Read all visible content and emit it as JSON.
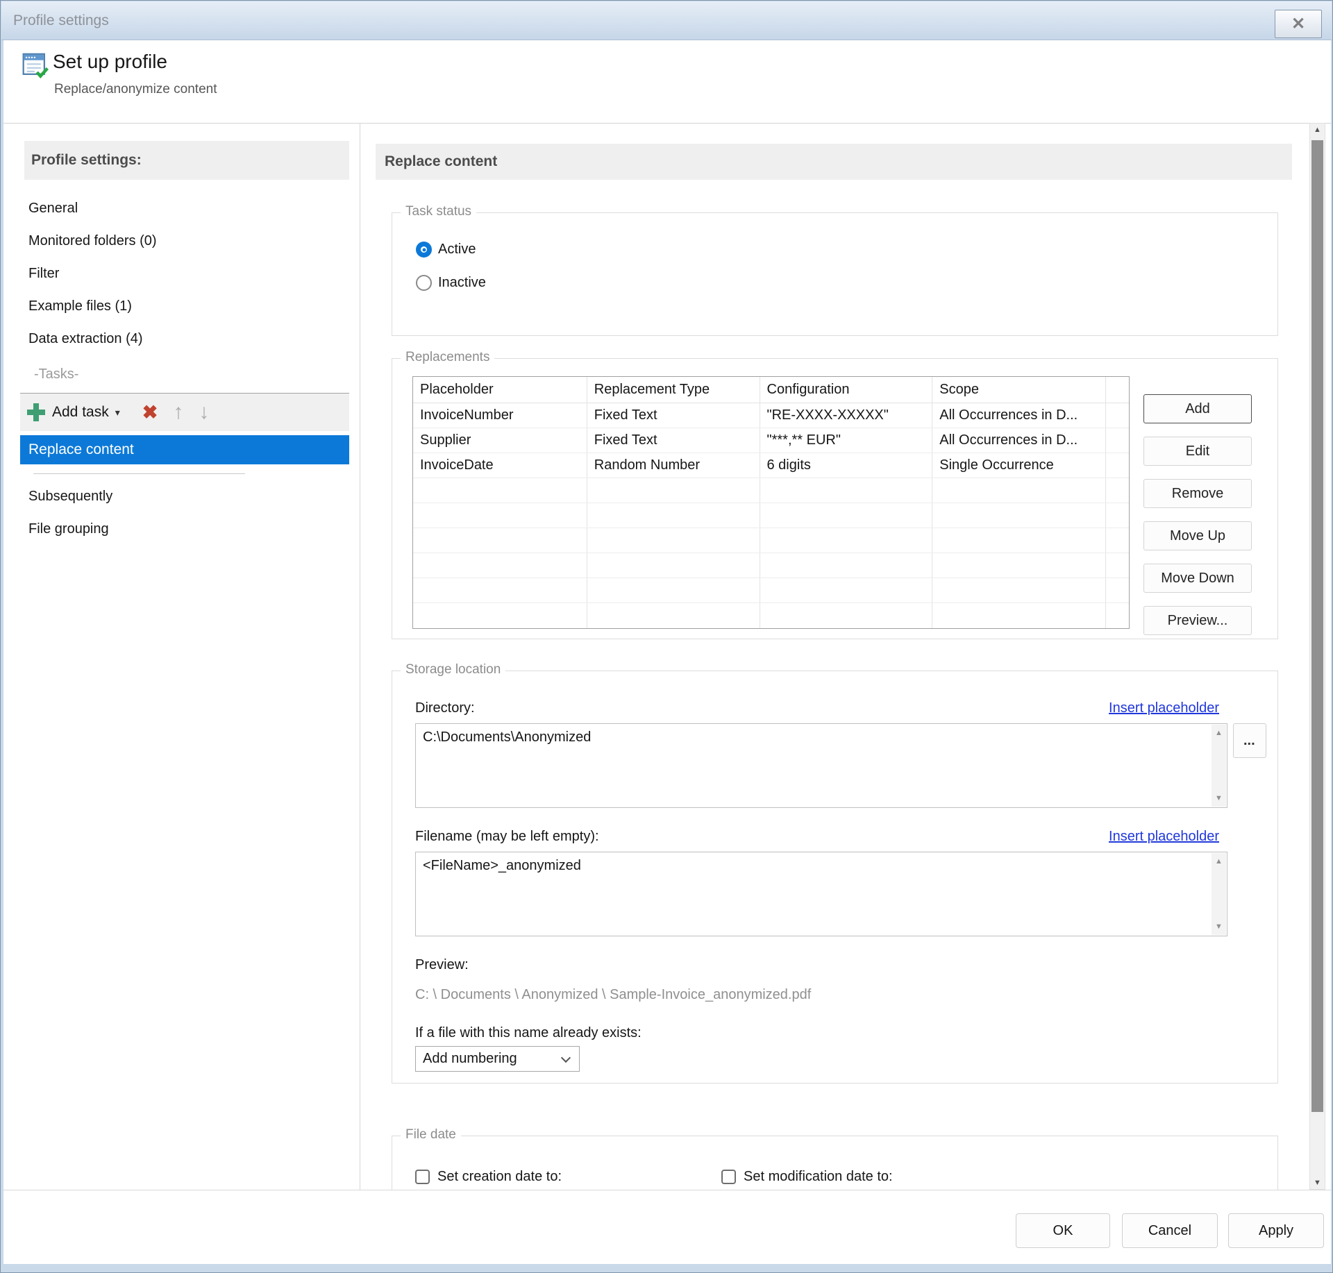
{
  "window": {
    "title": "Profile settings",
    "close_glyph": "✕"
  },
  "header": {
    "title": "Set up profile",
    "subtitle": "Replace/anonymize content"
  },
  "sidebar": {
    "heading": "Profile settings:",
    "items": [
      "General",
      "Monitored folders (0)",
      "Filter",
      "Example files (1)",
      "Data extraction (4)"
    ],
    "tasks_label": "-Tasks-",
    "add_task_label": "Add task",
    "selected_task": "Replace content",
    "other_tasks": [
      "Subsequently",
      "File grouping"
    ]
  },
  "main": {
    "title": "Replace content",
    "task_status": {
      "legend": "Task status",
      "active_label": "Active",
      "inactive_label": "Inactive"
    },
    "replacements": {
      "legend": "Replacements",
      "columns": [
        "Placeholder",
        "Replacement Type",
        "Configuration",
        "Scope"
      ],
      "rows": [
        [
          "InvoiceNumber",
          "Fixed Text",
          "\"RE-XXXX-XXXXX\"",
          "All Occurrences in D..."
        ],
        [
          "Supplier",
          "Fixed Text",
          "\"***,** EUR\"",
          "All Occurrences in D..."
        ],
        [
          "InvoiceDate",
          "Random Number",
          "6 digits",
          "Single Occurrence"
        ]
      ],
      "buttons": [
        "Add",
        "Edit",
        "Remove",
        "Move Up",
        "Move Down",
        "Preview..."
      ]
    },
    "storage": {
      "legend": "Storage location",
      "directory_label": "Directory:",
      "insert_placeholder_link": "Insert placeholder",
      "directory_value": "C:\\Documents\\Anonymized",
      "browse_label": "...",
      "filename_label": "Filename (may be left empty):",
      "filename_value": "<FileName>_anonymized",
      "preview_label": "Preview:",
      "preview_value": "C: \\ Documents \\ Anonymized \\ Sample-Invoice_anonymized.pdf",
      "exists_label": "If a file with this name already exists:",
      "exists_value": "Add numbering"
    },
    "file_date": {
      "legend": "File date",
      "creation_label": "Set creation date to:",
      "modification_label": "Set modification date to:"
    }
  },
  "footer": {
    "ok": "OK",
    "cancel": "Cancel",
    "apply": "Apply"
  },
  "colors": {
    "accent": "#0c79d8",
    "link": "#2038db",
    "add_green": "#3f9e72",
    "remove_red": "#c0432f"
  }
}
